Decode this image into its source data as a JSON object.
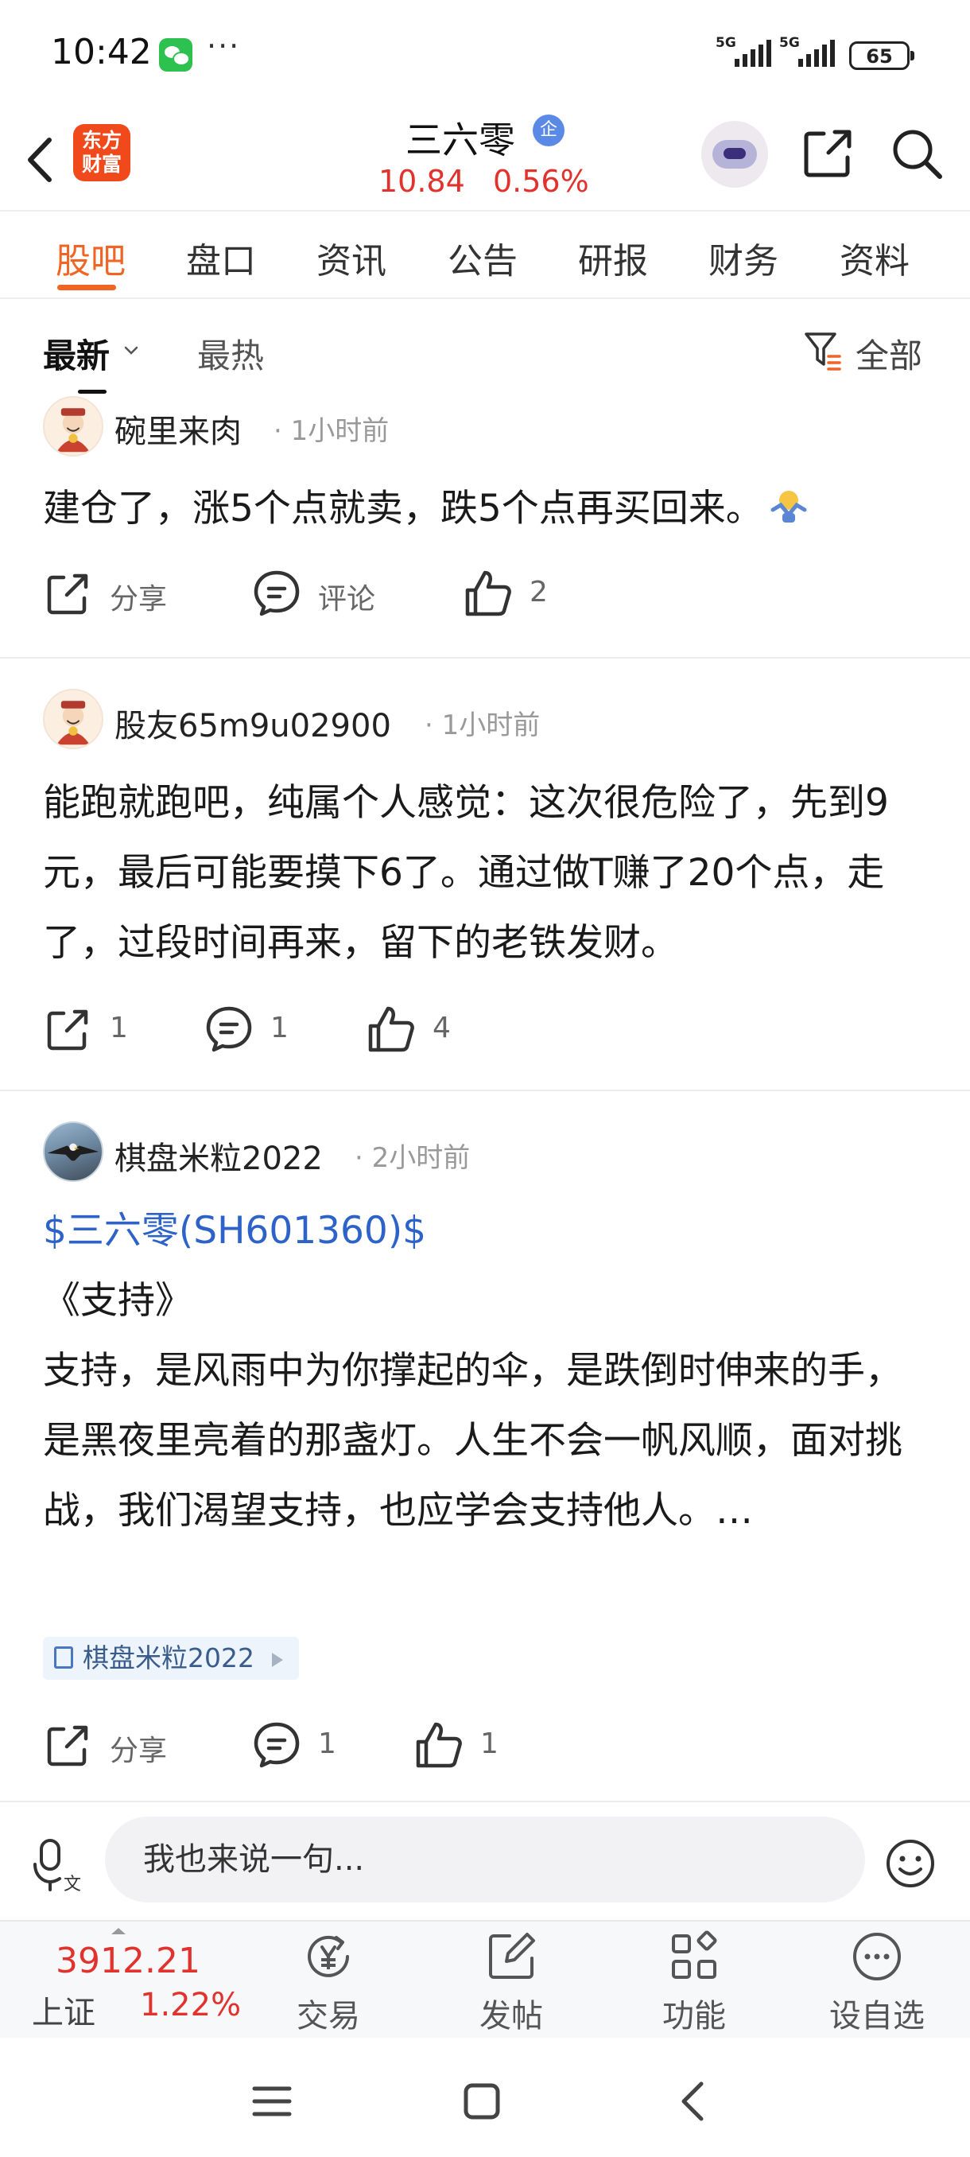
{
  "status_bar": {
    "time": "10:42",
    "signal1": "5G",
    "signal2": "5G",
    "battery": "65"
  },
  "header": {
    "logo": "东方\n财富",
    "stock_name": "三六零",
    "badge": "企",
    "price": "10.84",
    "change_pct": "0.56%"
  },
  "tabs": [
    {
      "label": "股吧",
      "active": true
    },
    {
      "label": "盘口"
    },
    {
      "label": "资讯"
    },
    {
      "label": "公告"
    },
    {
      "label": "研报"
    },
    {
      "label": "财务"
    },
    {
      "label": "资料"
    }
  ],
  "filter": {
    "latest": "最新",
    "hot": "最热",
    "all": "全部"
  },
  "posts": [
    {
      "author": "碗里来肉",
      "time": "1小时前",
      "content": "建仓了，涨5个点就卖，跌5个点再买回来。",
      "actions": {
        "share": "分享",
        "comment": "评论",
        "likes": "2"
      }
    },
    {
      "author": "股友65m9u02900",
      "time": "1小时前",
      "content": "能跑就跑吧，纯属个人感觉：这次很危险了，先到9元，最后可能要摸下6了。通过做T赚了20个点，走了，过段时间再来，留下的老铁发财。",
      "actions": {
        "share": "1",
        "comment": "1",
        "likes": "4"
      }
    },
    {
      "author": "棋盘米粒2022",
      "time": "2小时前",
      "stock_tag": "$三六零(SH601360)$",
      "title": "《支持》",
      "content": "支持，是风雨中为你撑起的伞，是跌倒时伸来的手，是黑夜里亮着的那盏灯。人生不会一帆风顺，面对挑战，我们渴望支持，也应学会支持他人。…",
      "source": "棋盘米粒2022",
      "actions": {
        "share": "分享",
        "comment": "1",
        "likes": "1"
      }
    }
  ],
  "comment_bar": {
    "placeholder": "我也来说一句..."
  },
  "toolbar": {
    "index_value": "3912.21",
    "index_name": "上证",
    "index_pct": "1.22%",
    "items": [
      {
        "label": "交易",
        "icon": "yen-exchange-icon"
      },
      {
        "label": "发帖",
        "icon": "edit-icon"
      },
      {
        "label": "功能",
        "icon": "grid-icon"
      },
      {
        "label": "设自选",
        "icon": "more-circle-icon"
      }
    ]
  },
  "colors": {
    "accent": "#f06424",
    "up_red": "#e2322d",
    "link_blue": "#2d63c8"
  }
}
